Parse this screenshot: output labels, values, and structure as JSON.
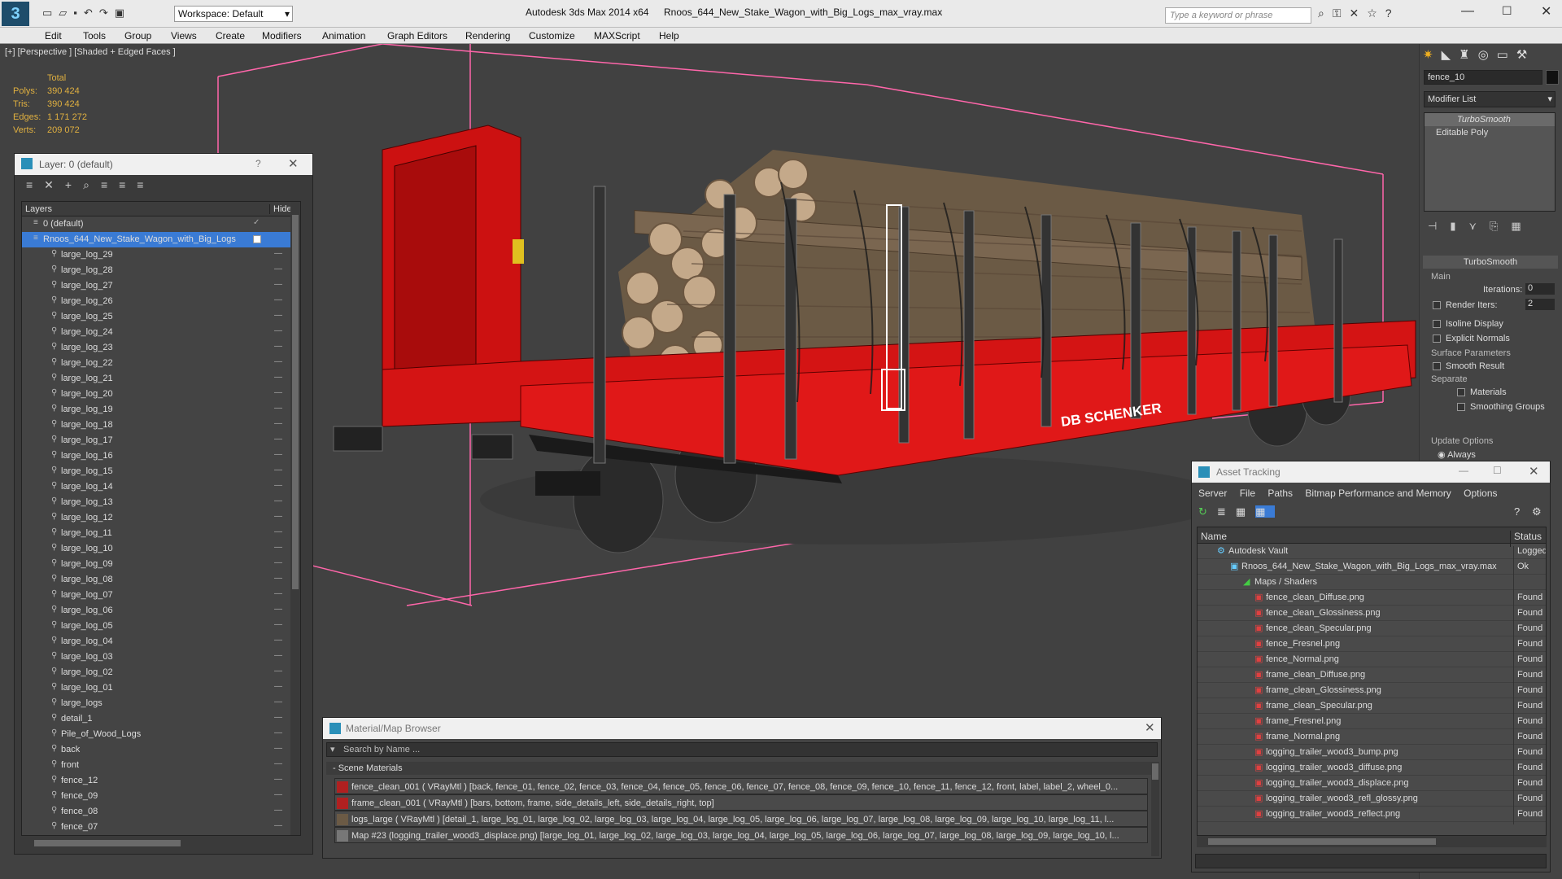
{
  "app": {
    "title": "Autodesk 3ds Max  2014 x64",
    "file": "Rnoos_644_New_Stake_Wagon_with_Big_Logs_max_vray.max",
    "workspace": "Workspace: Default",
    "search_placeholder": "Type a keyword or phrase"
  },
  "menu": [
    "Edit",
    "Tools",
    "Group",
    "Views",
    "Create",
    "Modifiers",
    "Animation",
    "Graph Editors",
    "Rendering",
    "Customize",
    "MAXScript",
    "Help"
  ],
  "viewport": {
    "label": "[+] [Perspective ] [Shaded + Edged Faces ]",
    "stats": {
      "header": "Total",
      "rows": [
        {
          "k": "Polys:",
          "v": "390 424"
        },
        {
          "k": "Tris:",
          "v": "390 424"
        },
        {
          "k": "Edges:",
          "v": "1 171 272"
        },
        {
          "k": "Verts:",
          "v": "209 072"
        }
      ]
    },
    "wagon_brand": "DB SCHENKER"
  },
  "layers": {
    "title": "Layer: 0 (default)",
    "help": "?",
    "col_layers": "Layers",
    "col_hide": "Hide",
    "items": [
      "0 (default)",
      "Rnoos_644_New_Stake_Wagon_with_Big_Logs",
      "large_log_29",
      "large_log_28",
      "large_log_27",
      "large_log_26",
      "large_log_25",
      "large_log_24",
      "large_log_23",
      "large_log_22",
      "large_log_21",
      "large_log_20",
      "large_log_19",
      "large_log_18",
      "large_log_17",
      "large_log_16",
      "large_log_15",
      "large_log_14",
      "large_log_13",
      "large_log_12",
      "large_log_11",
      "large_log_10",
      "large_log_09",
      "large_log_08",
      "large_log_07",
      "large_log_06",
      "large_log_05",
      "large_log_04",
      "large_log_03",
      "large_log_02",
      "large_log_01",
      "large_logs",
      "detail_1",
      "Pile_of_Wood_Logs",
      "back",
      "front",
      "fence_12",
      "fence_09",
      "fence_08",
      "fence_07"
    ]
  },
  "command_panel": {
    "object_name": "fence_10",
    "modifier_list": "Modifier List",
    "stack": [
      "TurboSmooth",
      "Editable Poly"
    ],
    "rollout": "TurboSmooth",
    "main": "Main",
    "iterations_label": "Iterations:",
    "iterations": "0",
    "render_iters_label": "Render Iters:",
    "render_iters": "2",
    "isoline": "Isoline Display",
    "explicit": "Explicit Normals",
    "surface": "Surface Parameters",
    "smooth_result": "Smooth Result",
    "separate": "Separate",
    "materials": "Materials",
    "smoothing": "Smoothing Groups",
    "update": "Update Options",
    "always": "Always"
  },
  "asset": {
    "title": "Asset Tracking",
    "menu": [
      "Server",
      "File",
      "Paths",
      "Bitmap Performance and Memory",
      "Options"
    ],
    "col_name": "Name",
    "col_status": "Status",
    "rows": [
      {
        "name": "Autodesk Vault",
        "status": "Logged O",
        "indent": 1
      },
      {
        "name": "Rnoos_644_New_Stake_Wagon_with_Big_Logs_max_vray.max",
        "status": "Ok",
        "indent": 2
      },
      {
        "name": "Maps / Shaders",
        "status": "",
        "indent": 3
      },
      {
        "name": "fence_clean_Diffuse.png",
        "status": "Found",
        "indent": 4
      },
      {
        "name": "fence_clean_Glossiness.png",
        "status": "Found",
        "indent": 4
      },
      {
        "name": "fence_clean_Specular.png",
        "status": "Found",
        "indent": 4
      },
      {
        "name": "fence_Fresnel.png",
        "status": "Found",
        "indent": 4
      },
      {
        "name": "fence_Normal.png",
        "status": "Found",
        "indent": 4
      },
      {
        "name": "frame_clean_Diffuse.png",
        "status": "Found",
        "indent": 4
      },
      {
        "name": "frame_clean_Glossiness.png",
        "status": "Found",
        "indent": 4
      },
      {
        "name": "frame_clean_Specular.png",
        "status": "Found",
        "indent": 4
      },
      {
        "name": "frame_Fresnel.png",
        "status": "Found",
        "indent": 4
      },
      {
        "name": "frame_Normal.png",
        "status": "Found",
        "indent": 4
      },
      {
        "name": "logging_trailer_wood3_bump.png",
        "status": "Found",
        "indent": 4
      },
      {
        "name": "logging_trailer_wood3_diffuse.png",
        "status": "Found",
        "indent": 4
      },
      {
        "name": "logging_trailer_wood3_displace.png",
        "status": "Found",
        "indent": 4
      },
      {
        "name": "logging_trailer_wood3_refl_glossy.png",
        "status": "Found",
        "indent": 4
      },
      {
        "name": "logging_trailer_wood3_reflect.png",
        "status": "Found",
        "indent": 4
      }
    ]
  },
  "matbrowser": {
    "title": "Material/Map Browser",
    "search": "Search by Name ...",
    "section": "- Scene Materials",
    "rows": [
      "fence_clean_001  ( VRayMtl )  [back, fence_01, fence_02, fence_03, fence_04, fence_05, fence_06, fence_07, fence_08, fence_09, fence_10, fence_11, fence_12, front, label, label_2, wheel_0...",
      "frame_clean_001  ( VRayMtl )  [bars, bottom, frame, side_details_left, side_details_right, top]",
      "logs_large  ( VRayMtl )  [detail_1, large_log_01, large_log_02, large_log_03, large_log_04, large_log_05, large_log_06, large_log_07, large_log_08, large_log_09, large_log_10, large_log_11, l...",
      "Map #23 (logging_trailer_wood3_displace.png)  [large_log_01, large_log_02, large_log_03, large_log_04, large_log_05, large_log_06, large_log_07, large_log_08, large_log_09, large_log_10, l..."
    ]
  },
  "colors": {
    "accent": "#3a7bd5",
    "wagon": "#d41414",
    "stats": "#e0b040",
    "select": "#ff66aa"
  }
}
